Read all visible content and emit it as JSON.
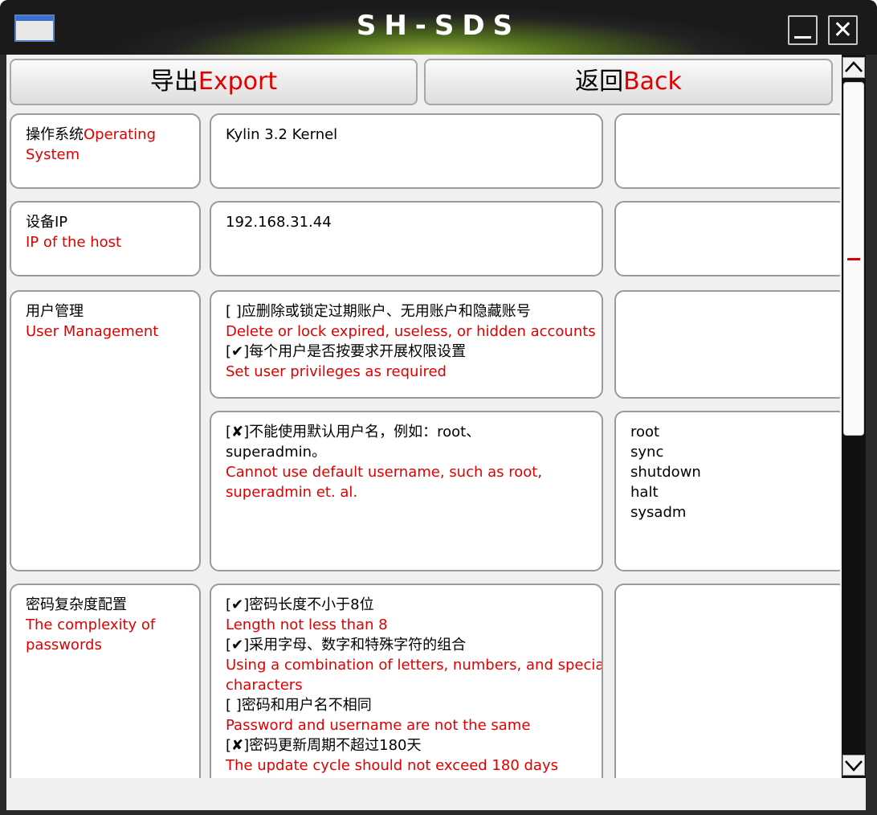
{
  "window": {
    "title": "SH-SDS"
  },
  "toolbar": {
    "export_cn": "导出",
    "export_en": "Export",
    "back_cn": "返回",
    "back_en": "Back"
  },
  "rows": {
    "os": {
      "label_cn": "操作系统",
      "label_en": "Operating System",
      "value": "Kylin 3.2 Kernel",
      "note": ""
    },
    "ip": {
      "label_cn": "设备IP",
      "label_en": "IP of the host",
      "value": "192.168.31.44",
      "note": ""
    },
    "users": {
      "label_cn": "用户管理",
      "label_en": "User Management",
      "item1_cn": "[    ]应删除或锁定过期账户、无用账户和隐藏账号",
      "item1_en": "Delete or lock expired, useless, or hidden accounts",
      "item2_cn": "[✔]每个用户是否按要求开展权限设置",
      "item2_en": "Set user privileges as required",
      "item3_cn_a": "[✘]不能使用默认用户名，例如：root、",
      "item3_cn_b": "superadmin。",
      "item3_en_a": "Cannot use default username, such as root,",
      "item3_en_b": "superadmin et. al.",
      "default_users": [
        "root",
        "sync",
        "shutdown",
        "halt",
        "sysadm"
      ]
    },
    "password": {
      "label_cn": "密码复杂度配置",
      "label_en_a": "The complexity of",
      "label_en_b": "passwords",
      "item1_cn": "[✔]密码长度不小于8位",
      "item1_en": "Length not less than 8",
      "item2_cn": "[✔]采用字母、数字和特殊字符的组合",
      "item2_en_a": "Using a combination of letters, numbers, and special",
      "item2_en_b": "characters",
      "item3_cn": "[    ]密码和用户名不相同",
      "item3_en": "Password and username are not the same",
      "item4_cn": "[✘]密码更新周期不超过180天",
      "item4_en": "The update cycle should not exceed 180 days"
    }
  },
  "icons": {
    "app": "window-icon",
    "minimize": "minimize-icon",
    "close": "close-icon",
    "scroll_up": "chevron-up-icon",
    "scroll_down": "chevron-down-icon"
  },
  "colors": {
    "accent_red": "#e00000",
    "titlebar_glow": "#8fb03a"
  }
}
